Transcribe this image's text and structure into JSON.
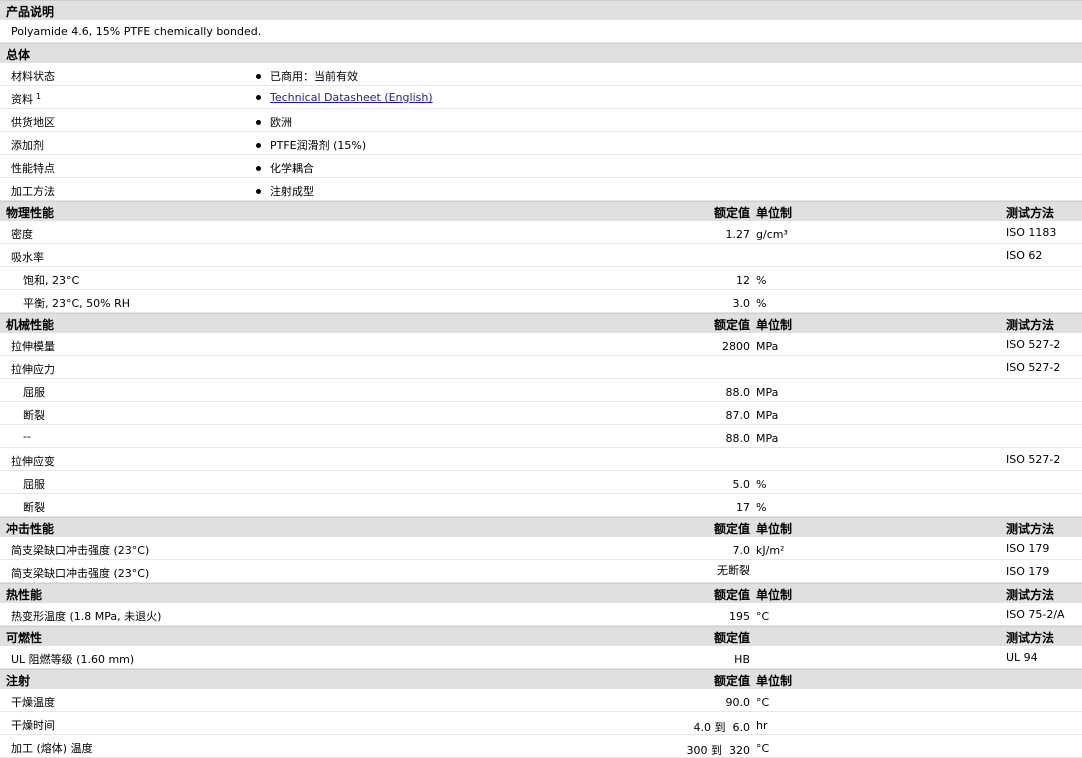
{
  "product_description": {
    "header": "产品说明",
    "text": "Polyamide 4.6, 15% PTFE chemically bonded."
  },
  "general": {
    "header": "总体",
    "rows": [
      {
        "label": "材料状态",
        "value": "已商用：当前有效"
      },
      {
        "label": "资料",
        "sup": "1",
        "value": "Technical Datasheet (English)",
        "link": true
      },
      {
        "label": "供货地区",
        "value": "欧洲"
      },
      {
        "label": "添加剂",
        "value": "PTFE润滑剂 (15%)"
      },
      {
        "label": "性能特点",
        "value": "化学耦合"
      },
      {
        "label": "加工方法",
        "value": "注射成型"
      }
    ]
  },
  "sections": [
    {
      "header": "物理性能",
      "nom": "额定值",
      "unit": "单位制",
      "method": "测试方法",
      "rows": [
        {
          "label": "密度",
          "value": "1.27",
          "unit": "g/cm³",
          "method": "ISO 1183"
        },
        {
          "label": "吸水率",
          "value": "",
          "unit": "",
          "method": "ISO 62"
        },
        {
          "label": "饱和, 23°C",
          "sub": true,
          "value": "12",
          "unit": "%",
          "method": ""
        },
        {
          "label": "平衡, 23°C, 50% RH",
          "sub": true,
          "value": "3.0",
          "unit": "%",
          "method": ""
        }
      ]
    },
    {
      "header": "机械性能",
      "nom": "额定值",
      "unit": "单位制",
      "method": "测试方法",
      "rows": [
        {
          "label": "拉伸模量",
          "value": "2800",
          "unit": "MPa",
          "method": "ISO 527-2"
        },
        {
          "label": "拉伸应力",
          "value": "",
          "unit": "",
          "method": "ISO 527-2"
        },
        {
          "label": "屈服",
          "sub": true,
          "value": "88.0",
          "unit": "MPa",
          "method": ""
        },
        {
          "label": "断裂",
          "sub": true,
          "value": "87.0",
          "unit": "MPa",
          "method": ""
        },
        {
          "label": "--",
          "sub": true,
          "value": "88.0",
          "unit": "MPa",
          "method": ""
        },
        {
          "label": "拉伸应变",
          "value": "",
          "unit": "",
          "method": "ISO 527-2"
        },
        {
          "label": "屈服",
          "sub": true,
          "value": "5.0",
          "unit": "%",
          "method": ""
        },
        {
          "label": "断裂",
          "sub": true,
          "value": "17",
          "unit": "%",
          "method": ""
        }
      ]
    },
    {
      "header": "冲击性能",
      "nom": "额定值",
      "unit": "单位制",
      "method": "测试方法",
      "rows": [
        {
          "label": "简支梁缺口冲击强度 (23°C)",
          "value": "7.0",
          "unit": "kJ/m²",
          "method": "ISO 179"
        },
        {
          "label": "简支梁缺口冲击强度 (23°C)",
          "value": "无断裂",
          "valtop": true,
          "unit": "",
          "method": "ISO 179"
        }
      ]
    },
    {
      "header": "热性能",
      "nom": "额定值",
      "unit": "单位制",
      "method": "测试方法",
      "rows": [
        {
          "label": "热变形温度 (1.8 MPa, 未退火)",
          "value": "195",
          "unit": "°C",
          "method": "ISO 75-2/A"
        }
      ]
    },
    {
      "header": "可燃性",
      "nom": "额定值",
      "unit": "",
      "method": "测试方法",
      "rows": [
        {
          "label": "UL 阻燃等级 (1.60 mm)",
          "value": "HB",
          "unit": "",
          "method": "UL 94"
        }
      ]
    },
    {
      "header": "注射",
      "nom": "额定值",
      "unit": "单位制",
      "method": "",
      "rows": [
        {
          "label": "干燥温度",
          "value": "90.0",
          "unit": "°C",
          "method": ""
        },
        {
          "label": "干燥时间",
          "value": "4.0 到  6.0",
          "unit": "hr",
          "method": ""
        },
        {
          "label": "加工 (熔体) 温度",
          "value": "300 到  320",
          "unit": "°C",
          "method": ""
        }
      ]
    }
  ]
}
